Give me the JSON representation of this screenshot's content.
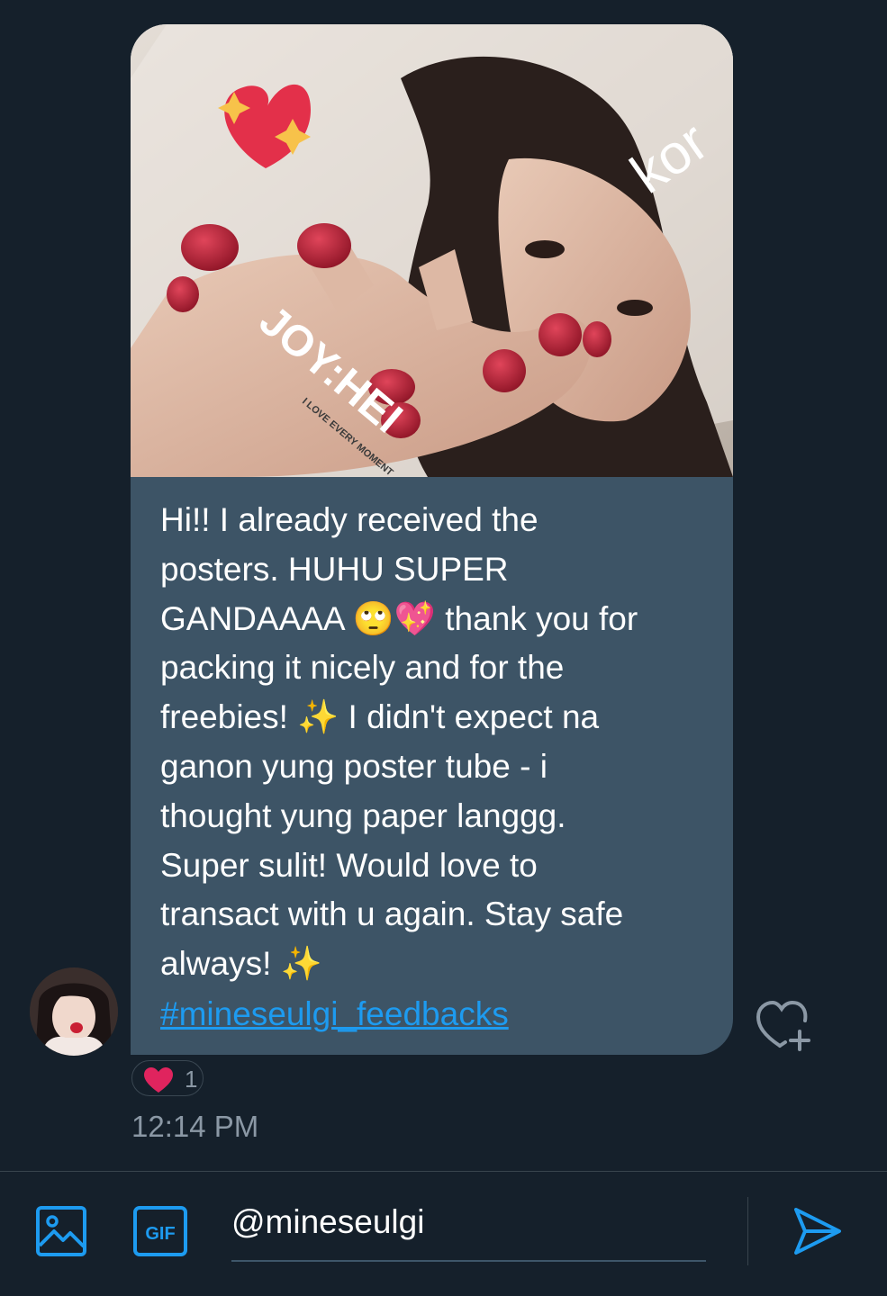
{
  "message": {
    "text": "Hi!! I already received the\nposters. HUHU SUPER\nGANDAAAA 🙄💖 thank you for\npacking it nicely and for the\nfreebies! ✨ I didn't expect na\nganon yung poster tube - i\nthought yung paper langgg.\nSuper sulit! Would love to\ntransact with u again. Stay safe\nalways! ✨",
    "hashtag": "#mineseulgi_feedbacks",
    "image_text": {
      "poster_title": "JOY:HEI",
      "poster_subtitle": "I LOVE EVERY MOMENT",
      "poster_corner": "kor"
    }
  },
  "reaction": {
    "icon": "heart-icon",
    "count": "1"
  },
  "timestamp": "12:14 PM",
  "composer": {
    "value": "@mineseulgi",
    "gif_label": "GIF"
  },
  "colors": {
    "background": "#15202b",
    "bubble": "#3d5466",
    "accent": "#1d9bf0",
    "muted": "#8b98a5",
    "heart": "#f91880"
  }
}
